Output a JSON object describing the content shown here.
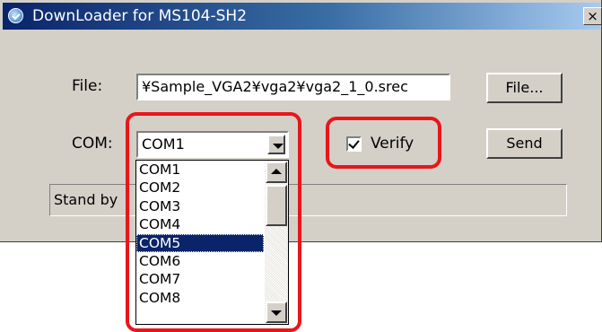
{
  "window": {
    "title": "DownLoader for MS104-SH2",
    "close_glyph": "×"
  },
  "form": {
    "file_label": "File:",
    "file_value": "¥Sample_VGA2¥vga2¥vga2_1_0.srec",
    "file_button": "File...",
    "com_label": "COM:",
    "com_selected": "COM1",
    "verify_label": "Verify",
    "verify_checked": true,
    "send_button": "Send"
  },
  "status": {
    "text": "Stand by"
  },
  "dropdown": {
    "items": [
      "COM1",
      "COM2",
      "COM3",
      "COM4",
      "COM5",
      "COM6",
      "COM7",
      "COM8"
    ],
    "selected_item": "COM5"
  },
  "colors": {
    "highlight": "#e8161b",
    "selection": "#0a246a",
    "titlebar": "#0a246a"
  },
  "icons": [
    "app-icon",
    "close-icon",
    "chevron-down-icon",
    "checkmark-icon",
    "scroll-up-icon",
    "scroll-down-icon"
  ]
}
